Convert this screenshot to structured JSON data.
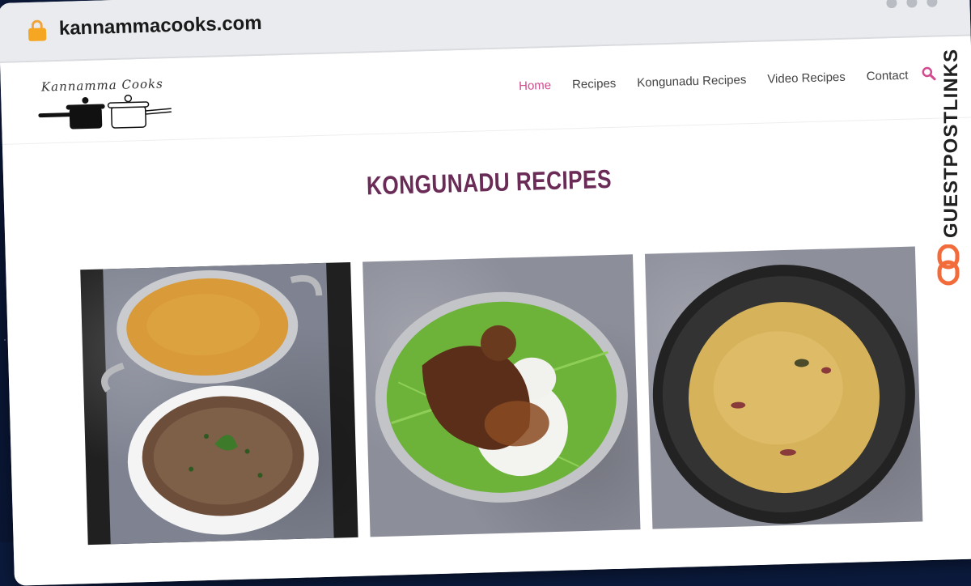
{
  "browser": {
    "url": "kannammacooks.com"
  },
  "site": {
    "logo_text": "Kannamma Cooks",
    "nav": [
      {
        "label": "Home",
        "active": true
      },
      {
        "label": "Recipes",
        "active": false
      },
      {
        "label": "Kongunadu Recipes",
        "active": false
      },
      {
        "label": "Video Recipes",
        "active": false
      },
      {
        "label": "Contact",
        "active": false
      }
    ],
    "page_title": "KONGUNADU RECIPES",
    "accent_color": "#d24b8e",
    "title_color": "#6a2b57"
  },
  "watermark": {
    "text": "GUESTPOSTLINKS"
  }
}
